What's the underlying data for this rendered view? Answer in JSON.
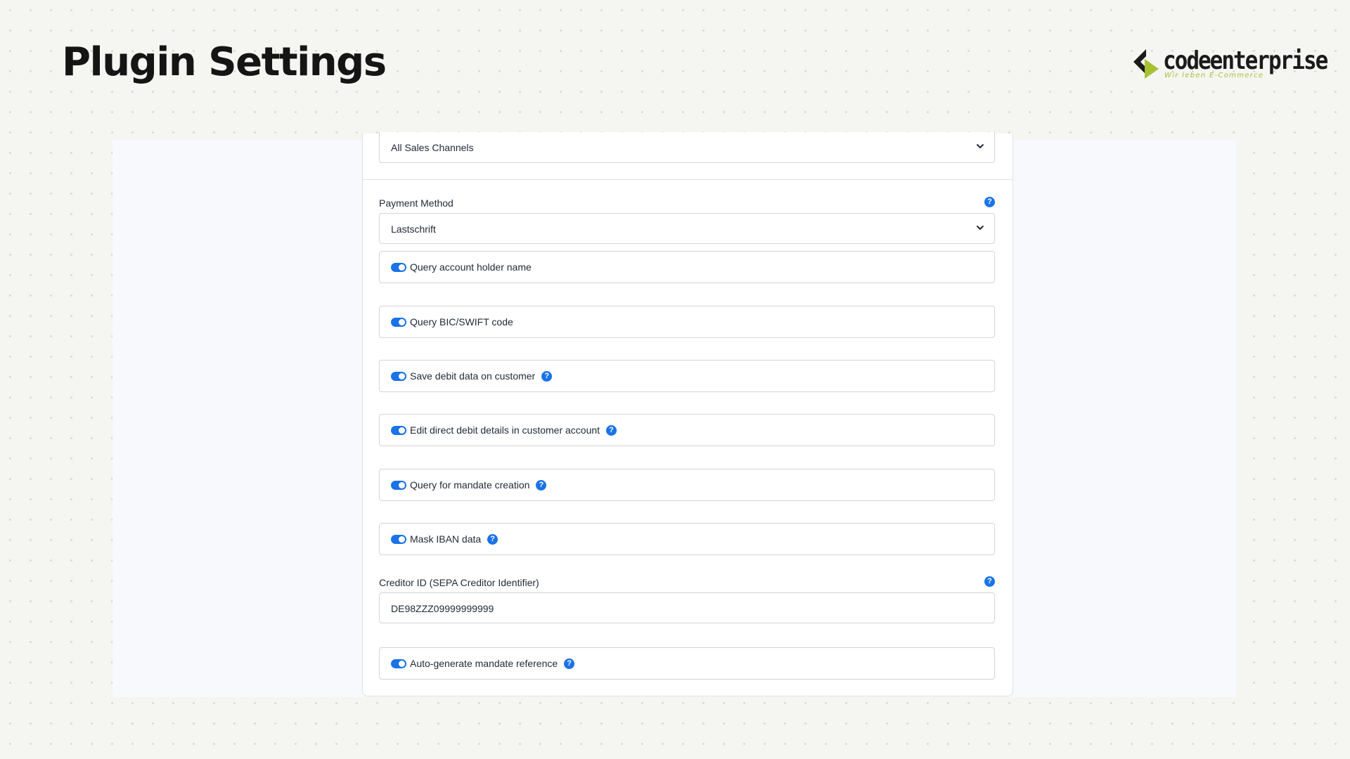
{
  "header": {
    "title": "Plugin Settings",
    "logo": {
      "name": "codeenterprise",
      "tagline": "Wir leben E-Commerce",
      "colors": {
        "dark": "#1b1b1b",
        "accent": "#a6c233"
      }
    }
  },
  "form": {
    "sales_channel": {
      "value": "All Sales Channels"
    },
    "payment_method": {
      "label": "Payment Method",
      "value": "Lastschrift",
      "help_icon": "question-mark-icon"
    },
    "toggles": [
      {
        "label": "Query account holder name",
        "enabled": true,
        "has_help": false
      },
      {
        "label": "Query BIC/SWIFT code",
        "enabled": true,
        "has_help": false
      },
      {
        "label": "Save debit data on customer",
        "enabled": true,
        "has_help": true
      },
      {
        "label": "Edit direct debit details in customer account",
        "enabled": true,
        "has_help": true
      },
      {
        "label": "Query for mandate creation",
        "enabled": true,
        "has_help": true
      },
      {
        "label": "Mask IBAN data",
        "enabled": true,
        "has_help": true
      }
    ],
    "creditor_id": {
      "label": "Creditor ID (SEPA Creditor Identifier)",
      "value": "DE98ZZZ09999999999"
    },
    "auto_mandate": {
      "label": "Auto-generate mandate reference",
      "enabled": true,
      "has_help": true
    }
  },
  "colors": {
    "accent": "#1a73e8",
    "border": "#d1d5db",
    "text": "#1e2a36"
  }
}
